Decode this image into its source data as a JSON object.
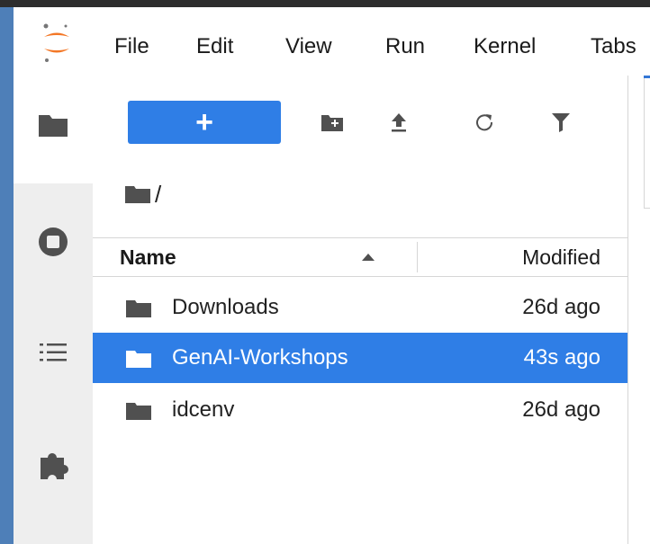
{
  "menubar": {
    "logo_icon": "jupyter-logo-icon",
    "items": [
      {
        "label": "File"
      },
      {
        "label": "Edit"
      },
      {
        "label": "View"
      },
      {
        "label": "Run"
      },
      {
        "label": "Kernel"
      },
      {
        "label": "Tabs"
      }
    ]
  },
  "activity_bar": {
    "items": [
      {
        "name": "file-browser",
        "icon": "folder-icon",
        "active": true
      },
      {
        "name": "running-kernels",
        "icon": "stop-circle-icon",
        "active": false
      },
      {
        "name": "table-of-contents",
        "icon": "list-icon",
        "active": false
      },
      {
        "name": "extensions",
        "icon": "puzzle-icon",
        "active": false
      }
    ]
  },
  "toolbar": {
    "new_label": "+",
    "buttons": [
      {
        "name": "new-folder",
        "icon": "new-folder-icon"
      },
      {
        "name": "upload",
        "icon": "upload-icon"
      },
      {
        "name": "refresh",
        "icon": "refresh-icon"
      },
      {
        "name": "filter",
        "icon": "filter-icon"
      }
    ]
  },
  "breadcrumb": {
    "root_icon": "folder-icon",
    "path": "/"
  },
  "file_list": {
    "columns": {
      "name": "Name",
      "modified": "Modified"
    },
    "sort": {
      "column": "Name",
      "direction": "ascending"
    },
    "rows": [
      {
        "name": "Downloads",
        "modified": "26d ago",
        "type": "folder",
        "selected": false
      },
      {
        "name": "GenAI-Workshops",
        "modified": "43s ago",
        "type": "folder",
        "selected": true
      },
      {
        "name": "idcenv",
        "modified": "26d ago",
        "type": "folder",
        "selected": false
      }
    ]
  },
  "colors": {
    "accent": "#2f7ee6",
    "left_strip": "#4e7fb8",
    "activity_bg": "#eeeeee",
    "icon_dark": "#555555"
  }
}
